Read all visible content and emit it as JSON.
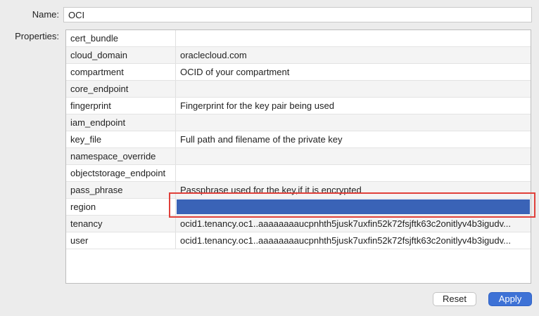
{
  "form": {
    "name_label": "Name:",
    "name_value": "OCI",
    "properties_label": "Properties:"
  },
  "properties": [
    {
      "key": "cert_bundle",
      "value": ""
    },
    {
      "key": "cloud_domain",
      "value": "oraclecloud.com"
    },
    {
      "key": "compartment",
      "value": "OCID of your compartment"
    },
    {
      "key": "core_endpoint",
      "value": ""
    },
    {
      "key": "fingerprint",
      "value": "Fingerprint for the key pair being used"
    },
    {
      "key": "iam_endpoint",
      "value": ""
    },
    {
      "key": "key_file",
      "value": "Full path and filename of the private key"
    },
    {
      "key": "namespace_override",
      "value": ""
    },
    {
      "key": "objectstorage_endpoint",
      "value": ""
    },
    {
      "key": "pass_phrase",
      "value": "Passphrase used for the key,if it is encrypted"
    },
    {
      "key": "region",
      "value": ""
    },
    {
      "key": "tenancy",
      "value": "ocid1.tenancy.oc1..aaaaaaaaucpnhth5jusk7uxfin52k72fsjftk63c2onitlyv4b3igudv..."
    },
    {
      "key": "user",
      "value": "ocid1.tenancy.oc1..aaaaaaaaucpnhth5jusk7uxfin52k72fsjftk63c2onitlyv4b3igudv..."
    }
  ],
  "buttons": {
    "reset_label": "Reset",
    "apply_label": "Apply"
  },
  "colors": {
    "selection": "#3a63b7",
    "highlight": "#e0403a",
    "apply_button": "#3e72d6"
  }
}
